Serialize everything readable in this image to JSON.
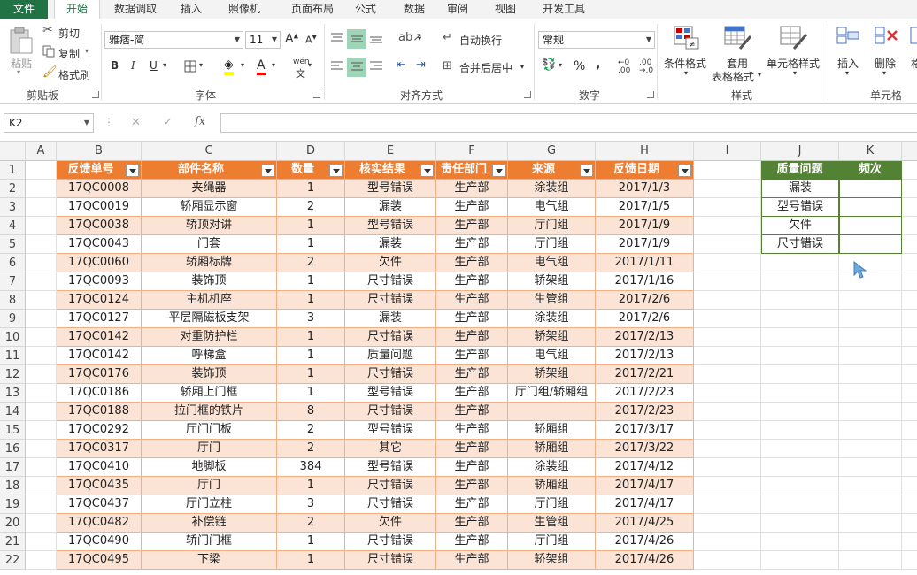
{
  "tabs": [
    "文件",
    "开始",
    "数据调取",
    "插入",
    "照像机",
    "页面布局",
    "公式",
    "数据",
    "审阅",
    "视图",
    "开发工具"
  ],
  "ribbon": {
    "clipboard": {
      "paste": "粘贴",
      "cut": "剪切",
      "copy": "复制",
      "format_painter": "格式刷",
      "label": "剪贴板"
    },
    "font": {
      "name": "雅痞-简",
      "size": "11",
      "bold": "B",
      "italic": "I",
      "underline": "U",
      "font_color": "A",
      "phonetic": "wén",
      "label": "字体"
    },
    "alignment": {
      "wrap": "自动换行",
      "merge": "合并后居中",
      "label": "对齐方式"
    },
    "number": {
      "format": "常规",
      "percent": "%",
      "comma": ",",
      "label": "数字"
    },
    "styles": {
      "conditional": "条件格式",
      "table_format_1": "套用",
      "table_format_2": "表格格式",
      "cell_styles": "单元格样式",
      "label": "样式"
    },
    "cells": {
      "insert": "插入",
      "delete": "删除",
      "format": "格",
      "label": "单元格"
    }
  },
  "formula_bar": {
    "name_box": "K2",
    "cancel": "✕",
    "enter": "✓",
    "fx": "fx",
    "formula": ""
  },
  "columns": [
    "A",
    "B",
    "C",
    "D",
    "E",
    "F",
    "G",
    "H",
    "I",
    "J",
    "K"
  ],
  "table_headers": [
    "反馈单号",
    "部件名称",
    "数量",
    "核实结果",
    "责任部门",
    "来源",
    "反馈日期"
  ],
  "rows": [
    [
      "17QC0008",
      "夹绳器",
      "1",
      "型号错误",
      "生产部",
      "涂装组",
      "2017/1/3"
    ],
    [
      "17QC0019",
      "轿厢显示窗",
      "2",
      "漏装",
      "生产部",
      "电气组",
      "2017/1/5"
    ],
    [
      "17QC0038",
      "轿顶对讲",
      "1",
      "型号错误",
      "生产部",
      "厅门组",
      "2017/1/9"
    ],
    [
      "17QC0043",
      "门套",
      "1",
      "漏装",
      "生产部",
      "厅门组",
      "2017/1/9"
    ],
    [
      "17QC0060",
      "轿厢标牌",
      "2",
      "欠件",
      "生产部",
      "电气组",
      "2017/1/11"
    ],
    [
      "17QC0093",
      "装饰顶",
      "1",
      "尺寸错误",
      "生产部",
      "轿架组",
      "2017/1/16"
    ],
    [
      "17QC0124",
      "主机机座",
      "1",
      "尺寸错误",
      "生产部",
      "生管组",
      "2017/2/6"
    ],
    [
      "17QC0127",
      "平层隔磁板支架",
      "3",
      "漏装",
      "生产部",
      "涂装组",
      "2017/2/6"
    ],
    [
      "17QC0142",
      "对重防护栏",
      "1",
      "尺寸错误",
      "生产部",
      "轿架组",
      "2017/2/13"
    ],
    [
      "17QC0142",
      "呼梯盒",
      "1",
      "质量问题",
      "生产部",
      "电气组",
      "2017/2/13"
    ],
    [
      "17QC0176",
      "装饰顶",
      "1",
      "尺寸错误",
      "生产部",
      "轿架组",
      "2017/2/21"
    ],
    [
      "17QC0186",
      "轿厢上门框",
      "1",
      "型号错误",
      "生产部",
      "厅门组/轿厢组",
      "2017/2/23"
    ],
    [
      "17QC0188",
      "拉门框的铁片",
      "8",
      "尺寸错误",
      "生产部",
      "",
      "2017/2/23"
    ],
    [
      "17QC0292",
      "厅门门板",
      "2",
      "型号错误",
      "生产部",
      "轿厢组",
      "2017/3/17"
    ],
    [
      "17QC0317",
      "厅门",
      "2",
      "其它",
      "生产部",
      "轿厢组",
      "2017/3/22"
    ],
    [
      "17QC0410",
      "地脚板",
      "384",
      "型号错误",
      "生产部",
      "涂装组",
      "2017/4/12"
    ],
    [
      "17QC0435",
      "厅门",
      "1",
      "尺寸错误",
      "生产部",
      "轿厢组",
      "2017/4/17"
    ],
    [
      "17QC0437",
      "厅门立柱",
      "3",
      "尺寸错误",
      "生产部",
      "厅门组",
      "2017/4/17"
    ],
    [
      "17QC0482",
      "补偿链",
      "2",
      "欠件",
      "生产部",
      "生管组",
      "2017/4/25"
    ],
    [
      "17QC0490",
      "轿门门框",
      "1",
      "尺寸错误",
      "生产部",
      "厅门组",
      "2017/4/26"
    ],
    [
      "17QC0495",
      "下梁",
      "1",
      "尺寸错误",
      "生产部",
      "轿架组",
      "2017/4/26"
    ]
  ],
  "summary": {
    "headers": [
      "质量问题",
      "频次"
    ],
    "items": [
      "漏装",
      "型号错误",
      "欠件",
      "尺寸错误"
    ]
  }
}
